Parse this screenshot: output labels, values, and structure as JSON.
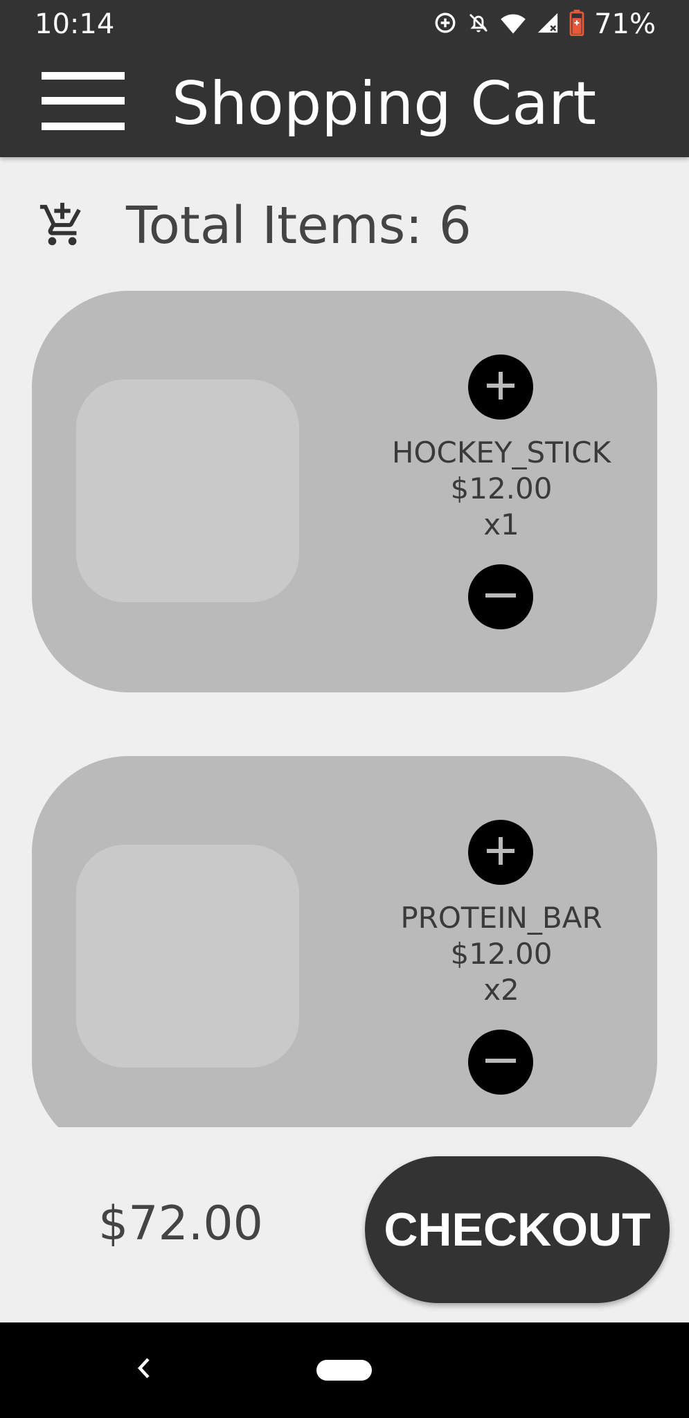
{
  "status_bar": {
    "time": "10:14",
    "battery_percent": "71%",
    "icons": [
      "data-saver-icon",
      "notifications-off-icon",
      "wifi-icon",
      "cell-signal-icon",
      "battery-icon"
    ]
  },
  "app_bar": {
    "title": "Shopping Cart",
    "menu_icon": "hamburger-menu-icon"
  },
  "summary": {
    "icon": "add-shopping-cart-icon",
    "total_items_label": "Total Items: 6"
  },
  "cart": {
    "items": [
      {
        "name": "HOCKEY_STICK",
        "price": "$12.00",
        "quantity": "x1"
      },
      {
        "name": "PROTEIN_BAR",
        "price": "$12.00",
        "quantity": "x2"
      }
    ]
  },
  "footer": {
    "total_price": "$72.00",
    "checkout_label": "CHECKOUT"
  },
  "colors": {
    "app_bar": "#333333",
    "background": "#efefef",
    "card": "#bababa",
    "image_placeholder": "#c9c9c9",
    "button_dark": "#000000",
    "battery_accent": "#e8583a"
  }
}
